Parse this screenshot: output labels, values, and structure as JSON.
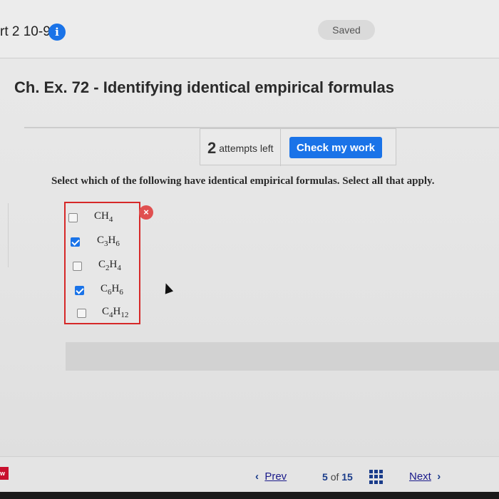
{
  "header": {
    "part_label": "rt 2 10-9",
    "info_icon": "i",
    "saved_label": "Saved"
  },
  "title": "Ch. Ex. 72 - Identifying identical empirical formulas",
  "attempts": {
    "count": "2",
    "label": "attempts left",
    "check_button": "Check my work"
  },
  "question": "Select which of the following have identical empirical formulas. Select all that apply.",
  "options": [
    {
      "element1": "C",
      "element2": "H",
      "sub1": "",
      "sub2": "4",
      "checked": false
    },
    {
      "element1": "C",
      "element2": "H",
      "sub1": "3",
      "sub2": "6",
      "checked": true
    },
    {
      "element1": "C",
      "element2": "H",
      "sub1": "2",
      "sub2": "4",
      "checked": false
    },
    {
      "element1": "C",
      "element2": "H",
      "sub1": "6",
      "sub2": "6",
      "checked": true
    },
    {
      "element1": "C",
      "element2": "H",
      "sub1": "4",
      "sub2": "12",
      "checked": false
    }
  ],
  "incorrect_icon": "×",
  "footer": {
    "logo": "w",
    "prev_label": "Prev",
    "page_current": "5",
    "page_of": "of",
    "page_total": "15",
    "next_label": "Next"
  },
  "colors": {
    "accent": "#1a73e8",
    "error": "#d62828",
    "nav_link": "#1a1a8a"
  }
}
